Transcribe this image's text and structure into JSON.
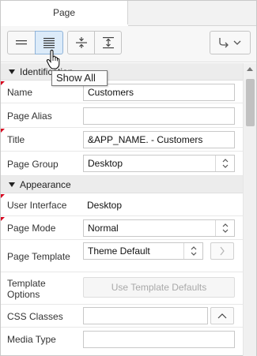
{
  "tabs": [
    {
      "label": "Page"
    }
  ],
  "toolbar": {
    "tooltip": "Show All",
    "buttons": [
      {
        "name": "show-common",
        "icon": "show-common-icon"
      },
      {
        "name": "show-all",
        "icon": "show-all-icon",
        "state": "pressed"
      },
      {
        "name": "collapse-all",
        "icon": "collapse-all-icon"
      },
      {
        "name": "expand-all",
        "icon": "expand-all-icon"
      },
      {
        "name": "go-to-group",
        "icon": "go-to-group-icon"
      }
    ]
  },
  "groups": {
    "identification": "Identification",
    "appearance": "Appearance"
  },
  "fields": {
    "name": {
      "label": "Name",
      "value": "Customers",
      "required": true
    },
    "page_alias": {
      "label": "Page Alias",
      "value": ""
    },
    "title": {
      "label": "Title",
      "value": "&APP_NAME. - Customers",
      "required": true
    },
    "page_group": {
      "label": "Page Group",
      "value": "Desktop"
    },
    "user_interface": {
      "label": "User Interface",
      "value": "Desktop",
      "required": true
    },
    "page_mode": {
      "label": "Page Mode",
      "value": "Normal",
      "required": true
    },
    "page_template": {
      "label": "Page Template",
      "value": "Theme Default"
    },
    "template_options": {
      "label": "Template Options",
      "button": "Use Template Defaults"
    },
    "css_classes": {
      "label": "CSS Classes",
      "value": ""
    },
    "media_type": {
      "label": "Media Type",
      "value": ""
    }
  },
  "colors": {
    "required_marker": "#d6001c",
    "active_button": "#dcebf9"
  }
}
